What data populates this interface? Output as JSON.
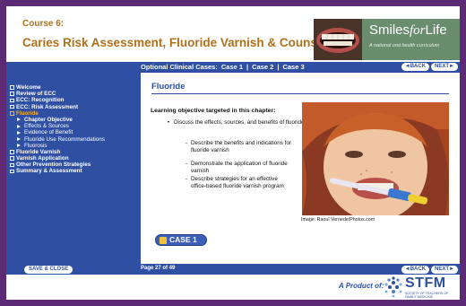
{
  "header": {
    "course_num": "Course 6:",
    "course_title": "Caries Risk Assessment, Fluoride Varnish & Counseling",
    "brand_name_1": "Smiles",
    "brand_name_2": "for",
    "brand_name_3": "Life",
    "brand_tagline": "A national oral health curriculum"
  },
  "topbar": {
    "optional_label": "Optional Clinical Cases:",
    "case1": "Case 1",
    "case2": "Case 2",
    "case3": "Case 3",
    "sep": "|",
    "back_label": "◄BACK",
    "next_label": "NEXT►"
  },
  "sidebar": {
    "items": [
      {
        "label": "Welcome"
      },
      {
        "label": "Review of ECC"
      },
      {
        "label": "ECC: Recognition"
      },
      {
        "label": "ECC: Risk Assessment"
      },
      {
        "label": "Fluoride"
      },
      {
        "label": "Chapter Objective"
      },
      {
        "label": "Effects & Sources"
      },
      {
        "label": "Evidence of Benefit"
      },
      {
        "label": "Fluoride Use Recommendations"
      },
      {
        "label": "Fluorosis"
      },
      {
        "label": "Fluoride Varnish"
      },
      {
        "label": "Varnish Application"
      },
      {
        "label": "Other Prevention Strategies"
      },
      {
        "label": "Summary & Assessment"
      }
    ]
  },
  "main": {
    "section_title": "Fluoride",
    "objective_heading": "Learning objective targeted in this chapter:",
    "bullet1": "Discuss the effects, sources, and benefits of fluoride",
    "sub1": "Describe the benefits and indications for fluoride varnish",
    "sub2": "Demonstrate the application of fluoride varnish",
    "sub3": "Describe strategies for an effective office-based fluoride varnish program",
    "caption": "Image: Raoul Vernede/Photos.com",
    "case_button": "CASE 1"
  },
  "bottombar": {
    "save_label": "SAVE & CLOSE",
    "page_label": "Page 27 of 49",
    "back_label": "◄BACK",
    "next_label": "NEXT►"
  },
  "footer": {
    "product_label": "A Product of:",
    "org_name": "STFM",
    "org_sub1": "SOCIETY OF TEACHERS OF",
    "org_sub2": "FAMILY MEDICINE"
  },
  "colors": {
    "outer": "#5c2a74",
    "nav_blue": "#2e4fa2",
    "active_orange": "#f5b03c",
    "title_brown": "#b0701a",
    "brand_green": "#6a8d6e"
  }
}
